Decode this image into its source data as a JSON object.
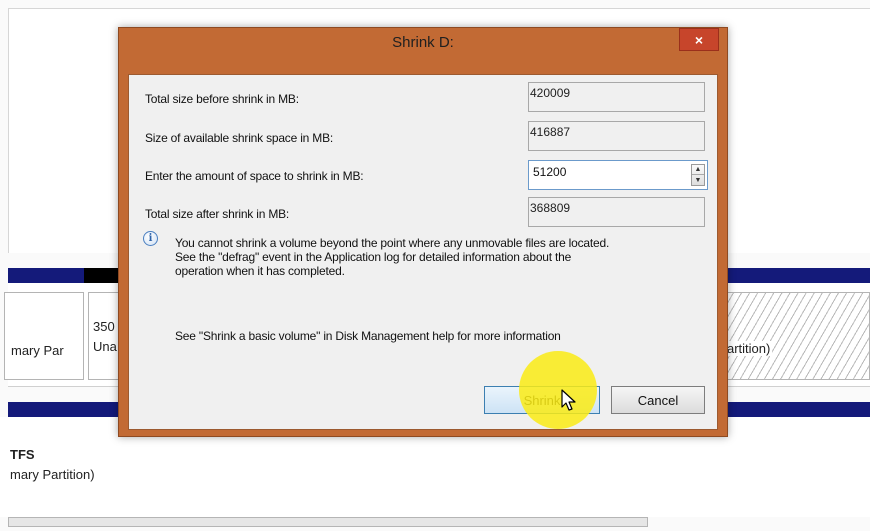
{
  "background": {
    "disk_cells": {
      "partition_left": "mary Par",
      "unallocated_size": "350",
      "unallocated_label": "Una",
      "partition_right": "artition)"
    },
    "lower": {
      "filesystem": "TFS",
      "partition_type": "mary Partition)"
    },
    "colors": {
      "disk_bar": "#141a7a"
    }
  },
  "dialog": {
    "title": "Shrink D:",
    "close_glyph": "×",
    "rows": [
      {
        "label": "Total size before shrink in MB:",
        "value": "420009"
      },
      {
        "label": "Size of available shrink space in MB:",
        "value": "416887"
      },
      {
        "label": "Enter the amount of space to shrink in MB:",
        "value": "51200"
      },
      {
        "label": "Total size after shrink in MB:",
        "value": "368809"
      }
    ],
    "info_icon": "info-icon",
    "info_lines": [
      "You cannot shrink a volume beyond the point where any unmovable files are located.",
      "See the \"defrag\" event in the Application log for detailed information about the",
      "operation when it has completed."
    ],
    "help_text": "See \"Shrink a basic volume\" in Disk Management help for more information",
    "buttons": {
      "shrink": "Shrink",
      "cancel": "Cancel"
    },
    "colors": {
      "frame": "#c26a34",
      "close_button": "#c7452b",
      "cursor_highlight": "#faeb14"
    }
  }
}
